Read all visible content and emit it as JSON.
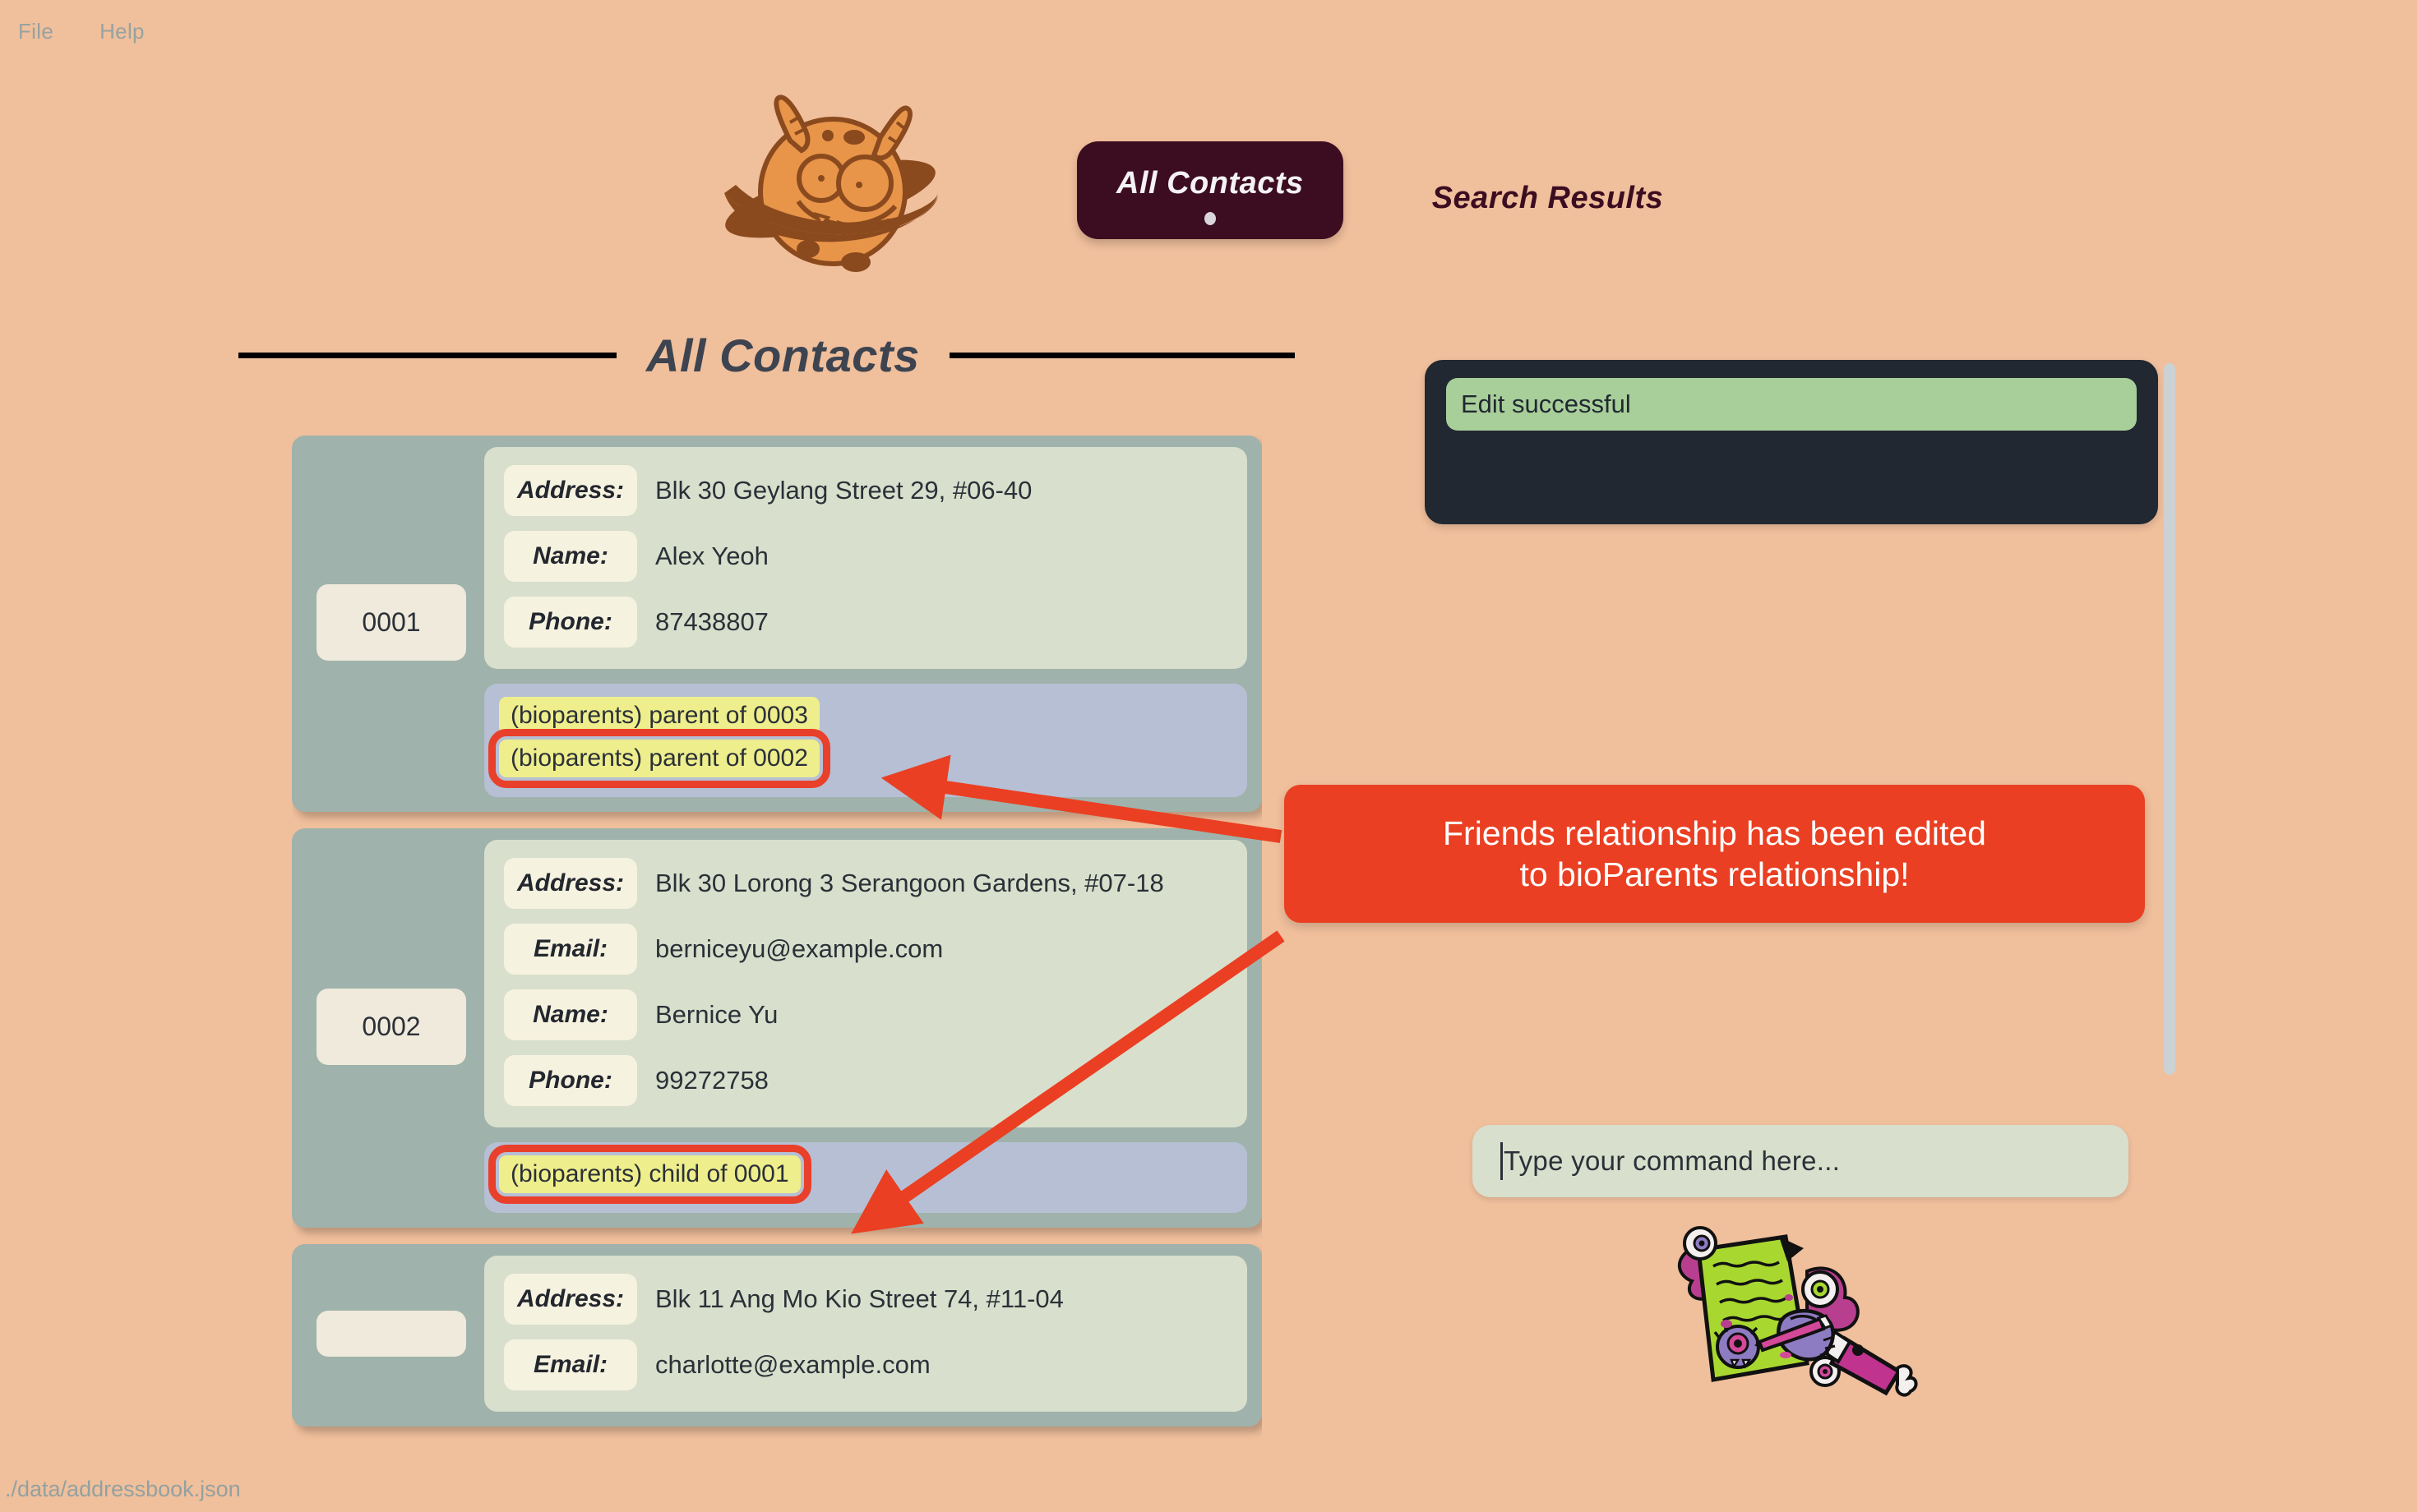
{
  "menubar": {
    "items": [
      {
        "label": "File"
      },
      {
        "label": "Help"
      }
    ]
  },
  "logo": {
    "icon": "planet-monster-logo"
  },
  "tabs": [
    {
      "label": "All Contacts",
      "active": true
    },
    {
      "label": "Search Results",
      "active": false
    }
  ],
  "section": {
    "title": "All Contacts"
  },
  "contacts": [
    {
      "id": "0001",
      "fields": [
        {
          "label": "Address:",
          "value": "Blk 30 Geylang Street 29, #06-40"
        },
        {
          "label": "Name:",
          "value": "Alex Yeoh"
        },
        {
          "label": "Phone:",
          "value": "87438807"
        }
      ],
      "relationships": [
        {
          "text": "(bioparents) parent of 0003",
          "highlighted": false
        },
        {
          "text": "(bioparents) parent of 0002",
          "highlighted": true
        }
      ]
    },
    {
      "id": "0002",
      "fields": [
        {
          "label": "Address:",
          "value": "Blk 30 Lorong 3 Serangoon Gardens, #07-18"
        },
        {
          "label": "Email:",
          "value": "berniceyu@example.com"
        },
        {
          "label": "Name:",
          "value": "Bernice Yu"
        },
        {
          "label": "Phone:",
          "value": "99272758"
        }
      ],
      "relationships": [
        {
          "text": "(bioparents) child of 0001",
          "highlighted": true
        }
      ]
    },
    {
      "id": "",
      "fields": [
        {
          "label": "Address:",
          "value": "Blk 11 Ang Mo Kio Street 74, #11-04"
        },
        {
          "label": "Email:",
          "value": "charlotte@example.com"
        }
      ],
      "relationships": []
    }
  ],
  "result_panel": {
    "message": "Edit successful"
  },
  "command_input": {
    "value": "",
    "placeholder": "Type your command here..."
  },
  "note_art": {
    "icon": "monster-notepad-illustration"
  },
  "annotation": {
    "line1": "Friends relationship has been edited",
    "line2": "to bioParents relationship!",
    "color": "#ea3f22"
  },
  "statusbar": {
    "path": "./data/addressbook.json"
  },
  "colors": {
    "background": "#f0bf9c",
    "tab_active_bg": "#3c0d20",
    "card_bg": "#9fb2ab",
    "detail_bg": "#d8dfcc",
    "relationship_bg": "#b6bfd4",
    "tag_bg": "#eeee8c",
    "result_panel_bg": "#222831",
    "success_bg": "#a8cf9a",
    "annotation_bg": "#ea3f22"
  }
}
